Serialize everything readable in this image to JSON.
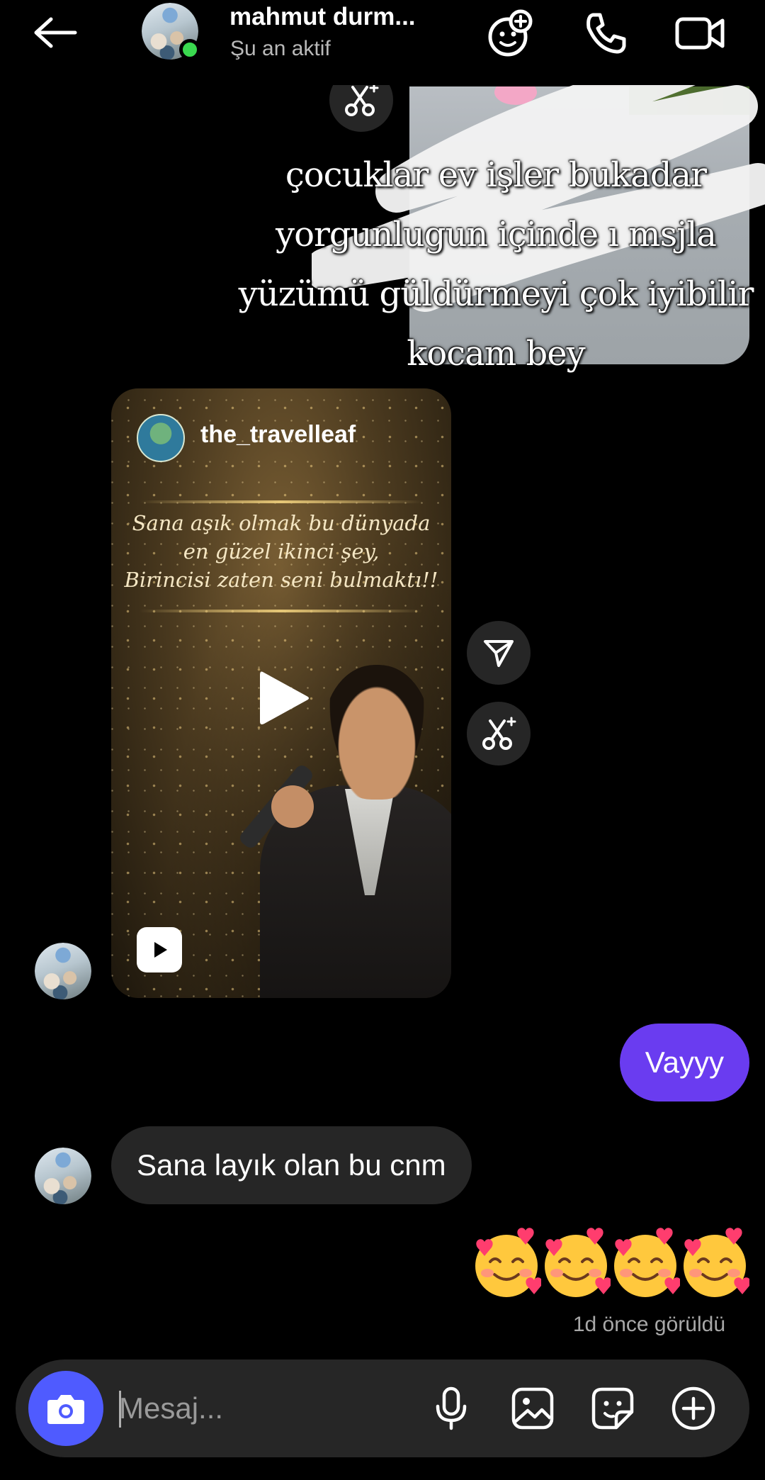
{
  "header": {
    "contact_name": "mahmut durm...",
    "status": "Şu an aktif",
    "icons": [
      "back-arrow-icon",
      "add-effect-icon",
      "phone-icon",
      "video-camera-icon"
    ]
  },
  "story_reply": {
    "caption_lines": [
      "çocuklar ev işler bukadar",
      "yorgunlugun içinde ı msjla",
      "yüzümü güldürmeyi çok iyibilir",
      "kocam bey"
    ]
  },
  "reel": {
    "username": "the_travelleaf",
    "quote_lines": [
      "Sana aşık olmak bu dünyada",
      "en güzel ikinci şey,",
      "Birincisi zaten seni bulmaktı!!"
    ],
    "icons": [
      "play-icon",
      "reels-icon",
      "share-icon",
      "remix-icon"
    ]
  },
  "messages": [
    {
      "direction": "outgoing",
      "text": "Vayyy"
    },
    {
      "direction": "incoming",
      "text": "Sana layık olan bu cnm"
    },
    {
      "direction": "outgoing",
      "text": "🥰🥰🥰🥰"
    }
  ],
  "emojis": [
    "🥰",
    "🥰",
    "🥰",
    "🥰"
  ],
  "seen_status": "1d önce görüldü",
  "composer": {
    "placeholder": "Mesaj...",
    "icons": [
      "camera-icon",
      "microphone-icon",
      "gallery-icon",
      "sticker-icon",
      "plus-icon"
    ]
  },
  "colors": {
    "background": "#000000",
    "outgoing_bubble": "#6a3cf0",
    "incoming_bubble": "#262626",
    "camera_button": "#4f5bff",
    "online_dot": "#3ad94f"
  }
}
